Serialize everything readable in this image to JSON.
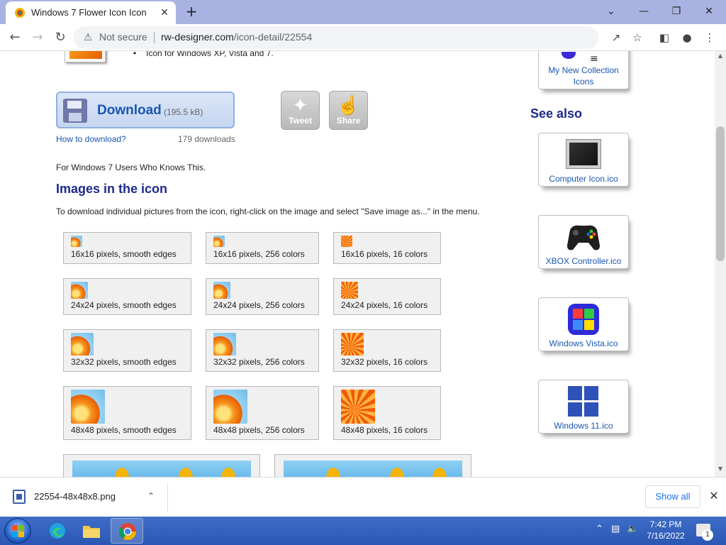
{
  "browser": {
    "tab_title": "Windows 7 Flower Icon Icon",
    "tab_close": "✕",
    "new_tab": "+",
    "security_label": "Not secure",
    "url_host": "rw-designer.com",
    "url_path": "/icon-detail/22554",
    "window_controls": [
      "⌄",
      "—",
      "❐",
      "✕"
    ]
  },
  "page": {
    "bullet_text": "Icon for Windows XP, Vista and 7.",
    "download_label": "Download",
    "download_size": "(195.5 kB)",
    "tweet_label": "Tweet",
    "share_label": "Share",
    "how_to_download": "How to download?",
    "download_count": "179 downloads",
    "description": "For Windows 7 Users Who Knows This.",
    "section_title": "Images in the icon",
    "instructions": "To download individual pictures from the icon, right-click on the image and select \"Save image as...\" in the menu.",
    "images": [
      {
        "label": "16x16 pixels, smooth edges"
      },
      {
        "label": "16x16 pixels, 256 colors"
      },
      {
        "label": "16x16 pixels, 16 colors"
      },
      {
        "label": "24x24 pixels, smooth edges"
      },
      {
        "label": "24x24 pixels, 256 colors"
      },
      {
        "label": "24x24 pixels, 16 colors"
      },
      {
        "label": "32x32 pixels, smooth edges"
      },
      {
        "label": "32x32 pixels, 256 colors"
      },
      {
        "label": "32x32 pixels, 16 colors"
      },
      {
        "label": "48x48 pixels, smooth edges"
      },
      {
        "label": "48x48 pixels, 256 colors"
      },
      {
        "label": "48x48 pixels, 16 colors"
      }
    ]
  },
  "sidebar": {
    "collection_caption": "My New Collection Icons",
    "see_also_title": "See also",
    "items": [
      {
        "caption": "Computer Icon.ico",
        "icon": "computer-icon"
      },
      {
        "caption": "XBOX Controller.ico",
        "icon": "xbox-controller-icon"
      },
      {
        "caption": "Windows Vista.ico",
        "icon": "windows-vista-icon"
      },
      {
        "caption": "Windows 11.ico",
        "icon": "windows-11-icon"
      }
    ]
  },
  "download_bar": {
    "filename": "22554-48x48x8.png",
    "show_all": "Show all"
  },
  "taskbar": {
    "time": "7:42 PM",
    "date": "7/16/2022",
    "notification_count": "1"
  },
  "colors": {
    "tabstrip": "#a9b3e2",
    "link": "#1a57b0",
    "heading": "#1c2a8c",
    "taskbar": "#2a57b3"
  }
}
